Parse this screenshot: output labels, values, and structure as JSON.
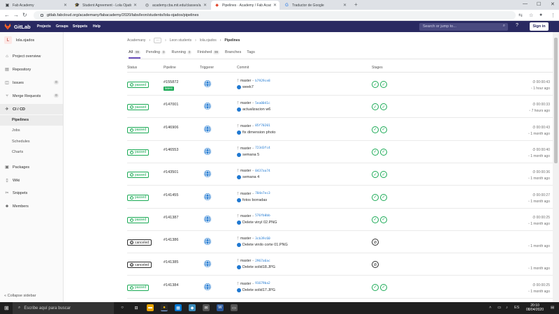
{
  "browser": {
    "tabs": [
      {
        "label": "Fab Academy",
        "icon": "fab-icon"
      },
      {
        "label": "Student Agreement - Lola Ojado",
        "icon": "cap-icon"
      },
      {
        "label": "academy.cba.mit.edu/classes/a...",
        "icon": "globe-icon"
      },
      {
        "label": "Pipelines · Academy / Fab Acad",
        "icon": "gitlab-icon"
      },
      {
        "label": "Traductor de Google",
        "icon": "translate-icon"
      }
    ],
    "url": "gitlab.fabcloud.org/academany/fabacademy/2020/labs/leon/students/lola-ojados/pipelines"
  },
  "gitlab": {
    "brand": "GitLab",
    "menu": [
      "Projects",
      "Groups",
      "Snippets",
      "Help"
    ],
    "search_placeholder": "Search or jump to...",
    "help": "?",
    "signin": "Sign in",
    "accent": "#292961"
  },
  "sidebar": {
    "project_initial": "L",
    "project_name": "lola.ojados",
    "items": [
      {
        "label": "Project overview",
        "icon": "home-icon"
      },
      {
        "label": "Repository",
        "icon": "doc-icon"
      },
      {
        "label": "Issues",
        "icon": "issues-icon",
        "badge": "0"
      },
      {
        "label": "Merge Requests",
        "icon": "merge-icon",
        "badge": "0"
      },
      {
        "label": "CI / CD",
        "icon": "rocket-icon"
      },
      {
        "label": "Packages",
        "icon": "package-icon"
      },
      {
        "label": "Wiki",
        "icon": "book-icon"
      },
      {
        "label": "Snippets",
        "icon": "scissors-icon"
      },
      {
        "label": "Members",
        "icon": "users-icon"
      }
    ],
    "subitems": [
      "Pipelines",
      "Jobs",
      "Schedules",
      "Charts"
    ],
    "collapse": "Collapse sidebar"
  },
  "breadcrumb": [
    "Academany",
    "···",
    "Leon students",
    "lola.ojados",
    "Pipelines"
  ],
  "pipeline_tabs": [
    {
      "label": "All",
      "count": "99"
    },
    {
      "label": "Pending",
      "count": "0"
    },
    {
      "label": "Running",
      "count": "0"
    },
    {
      "label": "Finished",
      "count": "99"
    },
    {
      "label": "Branches",
      "count": ""
    },
    {
      "label": "Tags",
      "count": ""
    }
  ],
  "columns": [
    "Status",
    "Pipeline",
    "Triggerer",
    "Commit",
    "Stages"
  ],
  "pipelines": [
    {
      "status": "passed",
      "id": "#155872",
      "latest": "latest",
      "branch": "master",
      "hash": "b7929ce8",
      "message": "week7",
      "stages": 2,
      "duration": "00:00:43",
      "ago": "1 hour ago"
    },
    {
      "status": "passed",
      "id": "#147001",
      "latest": "",
      "branch": "master",
      "hash": "5ea0041c",
      "message": "actualizacion w6",
      "stages": 2,
      "duration": "00:00:33",
      "ago": "7 hours ago"
    },
    {
      "status": "passed",
      "id": "#146906",
      "latest": "",
      "branch": "master",
      "hash": "05f70201",
      "message": "fix dimension photo",
      "stages": 2,
      "duration": "00:00:43",
      "ago": "1 month ago"
    },
    {
      "status": "passed",
      "id": "#146553",
      "latest": "",
      "branch": "master",
      "hash": "723d3fc4",
      "message": "semana 5",
      "stages": 2,
      "duration": "00:00:40",
      "ago": "1 month ago"
    },
    {
      "status": "passed",
      "id": "#143501",
      "latest": "",
      "branch": "master",
      "hash": "0437aa74",
      "message": "semana 4",
      "stages": 2,
      "duration": "00:00:36",
      "ago": "1 month ago"
    },
    {
      "status": "passed",
      "id": "#141455",
      "latest": "",
      "branch": "master",
      "hash": "704e7ec3",
      "message": "fotos borradas",
      "stages": 2,
      "duration": "00:00:27",
      "ago": "1 month ago"
    },
    {
      "status": "passed",
      "id": "#141387",
      "latest": "",
      "branch": "master",
      "hash": "576fb0bb",
      "message": "Delete vinyl 02.PNG",
      "stages": 2,
      "duration": "00:00:25",
      "ago": "1 month ago"
    },
    {
      "status": "canceled",
      "id": "#141386",
      "latest": "",
      "branch": "master",
      "hash": "3cb39c60",
      "message": "Delete vinilo corte 01.PNG",
      "stages": 1,
      "duration": "",
      "ago": "1 month ago"
    },
    {
      "status": "canceled",
      "id": "#141385",
      "latest": "",
      "branch": "master",
      "hash": "2967a6ac",
      "message": "Delete solid18.JPG",
      "stages": 1,
      "duration": "",
      "ago": "1 month ago"
    },
    {
      "status": "passed",
      "id": "#141384",
      "latest": "",
      "branch": "master",
      "hash": "91679ba2",
      "message": "Delete solid17.JPG",
      "stages": 2,
      "duration": "00:00:25",
      "ago": "1 month ago"
    }
  ],
  "taskbar": {
    "search_placeholder": "Escribe aquí para buscar",
    "time": "20:10",
    "date": "08/04/2020"
  }
}
